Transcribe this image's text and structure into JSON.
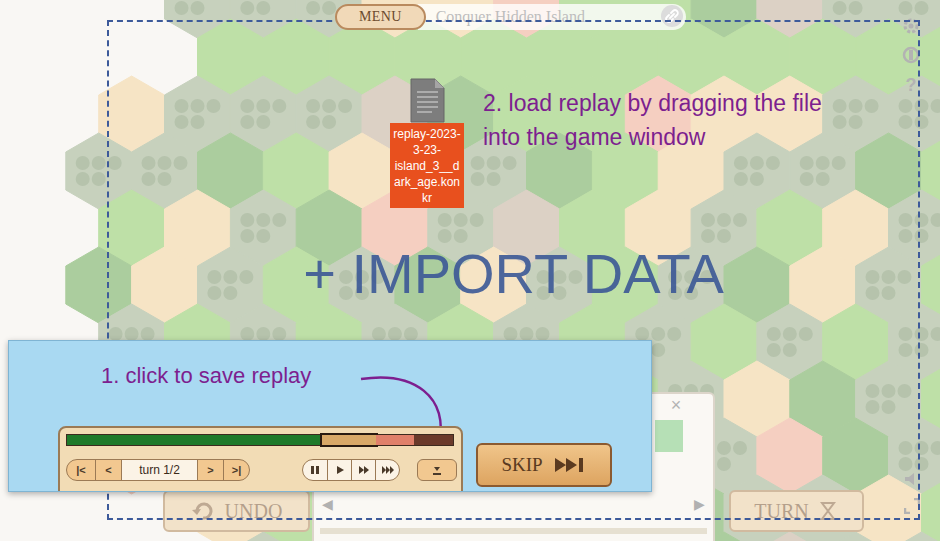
{
  "top_bar": {
    "menu": "MENU",
    "title": "Conquer Hidden Island",
    "help": "?"
  },
  "drop_zone": {
    "label": "+ IMPORT DATA"
  },
  "file": {
    "name": "replay-2023-3-23-island_3__dark_age.konkr"
  },
  "hints": [
    "1. click to save replay",
    "2. load replay by dragging the file into the game window"
  ],
  "replay": {
    "segments": [
      {
        "level": 0.66,
        "color": "#1f7a2a",
        "selected": false
      },
      {
        "level": 0.14,
        "color": "#d9a867",
        "selected": true
      },
      {
        "level": 0.1,
        "color": "#e0806a",
        "selected": false
      },
      {
        "level": 0.1,
        "color": "#6b3a2a",
        "selected": false
      }
    ],
    "nav": [
      "|<",
      "<",
      ">",
      ">|"
    ],
    "turn": "turn 1/2"
  },
  "skip": "SKIP",
  "buttons": {
    "undo": "UNDO",
    "turn": "TURN"
  },
  "dialog": {
    "close": "×",
    "prev": "◀",
    "next": "▶"
  }
}
